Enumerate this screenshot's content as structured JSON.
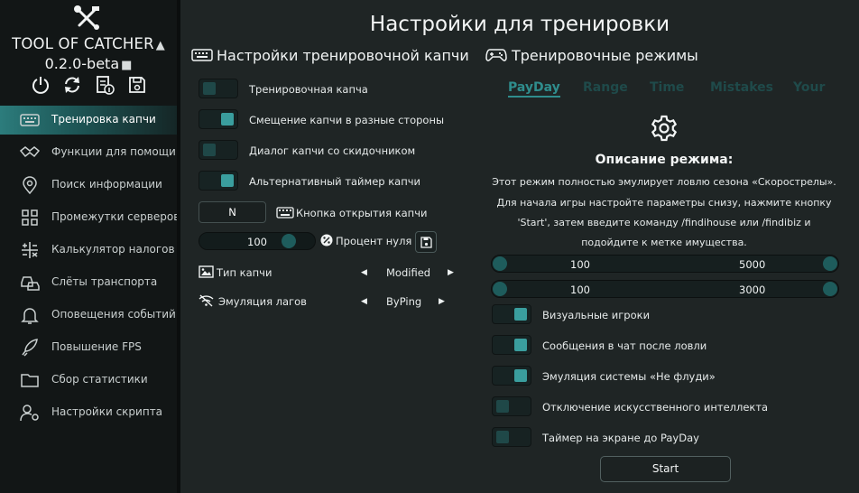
{
  "app": {
    "title": "TOOL OF CATCHER",
    "version": "0.2.0-beta"
  },
  "toolbar": [
    "power-icon",
    "refresh-icon",
    "document-info-icon",
    "save-icon"
  ],
  "sidebar": {
    "items": [
      {
        "label": "Тренировка капчи",
        "icon": "keyboard-icon",
        "active": true
      },
      {
        "label": "Функции для помощи",
        "icon": "handshake-icon"
      },
      {
        "label": "Поиск информации",
        "icon": "location-search-icon"
      },
      {
        "label": "Промежутки серверов",
        "icon": "grid-icon"
      },
      {
        "label": "Калькулятор налогов",
        "icon": "calculator-icon"
      },
      {
        "label": "Слёты транспорта",
        "icon": "cars-icon"
      },
      {
        "label": "Оповещения событий",
        "icon": "bell-icon"
      },
      {
        "label": "Повышение FPS",
        "icon": "rocket-icon"
      },
      {
        "label": "Сбор статистики",
        "icon": "folder-icon"
      },
      {
        "label": "Настройки скрипта",
        "icon": "user-gear-icon"
      }
    ]
  },
  "main": {
    "title": "Настройки для тренировки",
    "captcha": {
      "title": "Настройки тренировочной капчи",
      "options": [
        {
          "label": "Тренировочная капча",
          "on": false
        },
        {
          "label": "Смещение капчи в разные стороны",
          "on": true
        },
        {
          "label": "Диалог капчи со скидочником",
          "on": false
        },
        {
          "label": "Альтернативный таймер капчи",
          "on": true
        }
      ],
      "key_value": "N",
      "key_label": "Кнопка открытия капчи",
      "zero_percent": {
        "value": "100",
        "label": "Процент нуля",
        "fraction": 0.8
      },
      "captcha_type": {
        "label": "Тип капчи",
        "value": "Modified"
      },
      "lag_emulation": {
        "label": "Эмуляция лагов",
        "value": "ByPing"
      }
    },
    "modes": {
      "title": "Тренировочные режимы",
      "tabs": [
        "PayDay",
        "Range",
        "Time",
        "Mistakes",
        "Your"
      ],
      "active_tab": 0,
      "description_title": "Описание режима:",
      "description": [
        "Этот режим полностью эмулирует ловлю сезона «Скорострелы».",
        "Для начала игры настройте параметры снизу, нажмите кнопку",
        "'Start', затем введите команду /findihouse или /findibiz и",
        "подойдите к метке имущества."
      ],
      "range1": {
        "min": "100",
        "max": "5000"
      },
      "range2": {
        "min": "100",
        "max": "3000"
      },
      "options": [
        {
          "label": "Визуальные игроки",
          "on": true
        },
        {
          "label": "Сообщения в чат после ловли",
          "on": true
        },
        {
          "label": "Эмуляция системы «Не флуди»",
          "on": true
        },
        {
          "label": "Отключение искусственного интеллекта",
          "on": false
        },
        {
          "label": "Таймер на экране до PayDay",
          "on": false
        }
      ],
      "start_label": "Start"
    }
  },
  "colors": {
    "accent": "#2f8d8d",
    "sidebar": "#121616",
    "background": "#1f2525"
  }
}
